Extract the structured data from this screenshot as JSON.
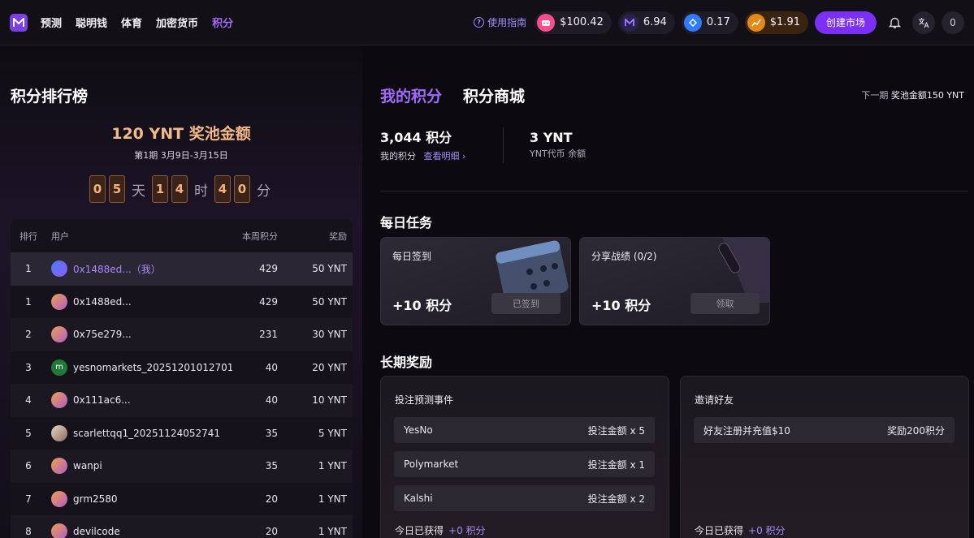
{
  "header": {
    "nav": [
      "预测",
      "聪明钱",
      "体育",
      "加密货币",
      "积分"
    ],
    "active_index": 4,
    "guide_label": "使用指南",
    "wallets": [
      {
        "icon": "robot-coin-icon",
        "value": "$100.42",
        "color": "#ff4d8d"
      },
      {
        "icon": "m-logo-coin-icon",
        "value": "6.94",
        "color": "#5b3ad1"
      },
      {
        "icon": "blue-token-icon",
        "value": "0.17",
        "color": "#2f7bff"
      },
      {
        "icon": "chart-coin-icon",
        "value": "$1.91",
        "color": "#e08a1a"
      }
    ],
    "create_label": "创建市场",
    "profile_count": "0"
  },
  "leaderboard": {
    "title": "积分排行榜",
    "next_label": "下一期",
    "next_pool": "奖池金额150 YNT",
    "pool_text": "120 YNT 奖池金额",
    "period_text": "第1期 3月9日-3月15日",
    "countdown": {
      "days": [
        "0",
        "5"
      ],
      "day_unit": "天",
      "hours": [
        "1",
        "4"
      ],
      "hour_unit": "时",
      "minutes": [
        "4",
        "0"
      ],
      "minute_unit": "分"
    },
    "columns": {
      "rank": "排行",
      "user": "用户",
      "points": "本周积分",
      "reward": "奖励"
    },
    "rows": [
      {
        "rank": "1",
        "user": "0x1488ed...（我）",
        "points": "429",
        "reward": "50 YNT",
        "me": true,
        "avatar": "gradient-blue"
      },
      {
        "rank": "1",
        "user": "0x1488ed...",
        "points": "429",
        "reward": "50 YNT",
        "avatar": "gradient-orange"
      },
      {
        "rank": "2",
        "user": "0x75e279...",
        "points": "231",
        "reward": "30 YNT",
        "avatar": "gradient-orange"
      },
      {
        "rank": "3",
        "user": "yesnomarkets_20251201012701",
        "points": "40",
        "reward": "20 YNT",
        "avatar": "green-m",
        "avatar_letter": "m"
      },
      {
        "rank": "4",
        "user": "0x111ac6...",
        "points": "40",
        "reward": "10 YNT",
        "avatar": "gradient-orange"
      },
      {
        "rank": "5",
        "user": "scarlettqq1_20251124052741",
        "points": "35",
        "reward": "5 YNT",
        "avatar": "photo"
      },
      {
        "rank": "6",
        "user": "wanpi",
        "points": "35",
        "reward": "1 YNT",
        "avatar": "gradient-orange"
      },
      {
        "rank": "7",
        "user": "grm2580",
        "points": "20",
        "reward": "1 YNT",
        "avatar": "gradient-orange"
      },
      {
        "rank": "8",
        "user": "devilcode",
        "points": "20",
        "reward": "1 YNT",
        "avatar": "gradient-orange"
      }
    ]
  },
  "tabs": {
    "mine": "我的积分",
    "shop": "积分商城"
  },
  "summary": {
    "points_value": "3,044 积分",
    "points_label": "我的积分",
    "detail_link": "查看明细",
    "ynt_value": "3 YNT",
    "ynt_label": "YNT代币 余额"
  },
  "daily": {
    "title": "每日任务",
    "tasks": [
      {
        "name": "每日签到",
        "reward": "+10 积分",
        "button": "已签到"
      },
      {
        "name": "分享战绩 (0/2)",
        "reward": "+10 积分",
        "button": "领取"
      }
    ]
  },
  "longterm": {
    "title": "长期奖励",
    "cards": [
      {
        "title": "投注预测事件",
        "rows": [
          {
            "name": "YesNo",
            "value": "投注金额 x 5"
          },
          {
            "name": "Polymarket",
            "value": "投注金额 x 1"
          },
          {
            "name": "Kalshi",
            "value": "投注金额 x 2"
          }
        ],
        "today_label": "今日已获得",
        "today_value": "+0 积分"
      },
      {
        "title": "邀请好友",
        "rows": [
          {
            "name": "好友注册并充值$10",
            "value": "奖励200积分"
          }
        ],
        "today_label": "今日已获得",
        "today_value": "+0 积分"
      }
    ]
  }
}
